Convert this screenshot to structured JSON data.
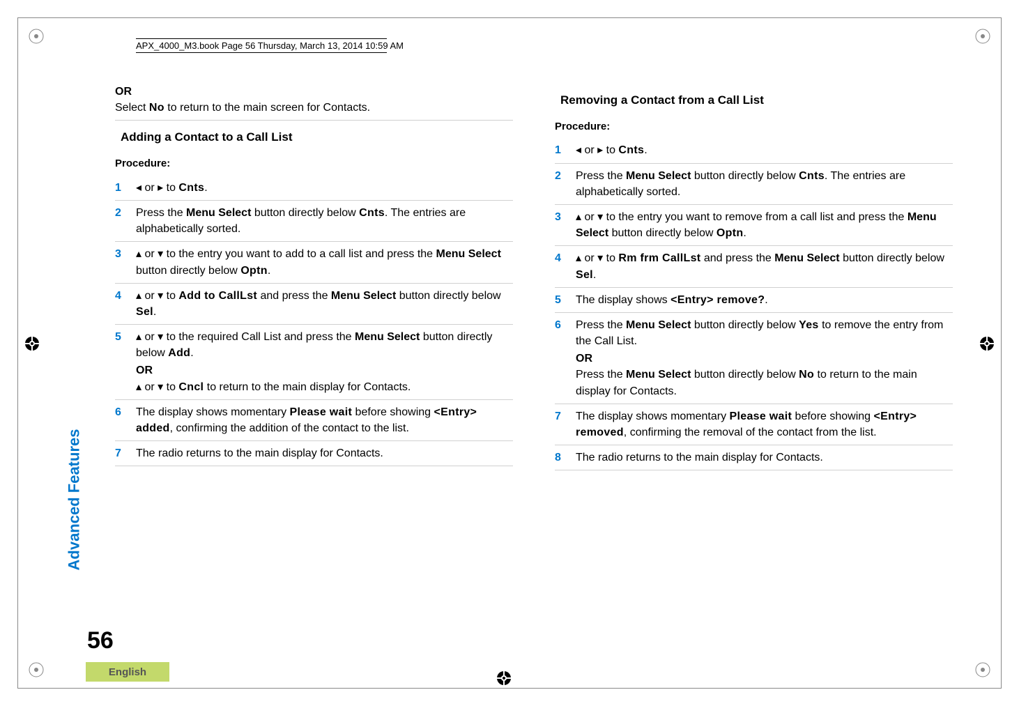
{
  "book_header": "APX_4000_M3.book  Page 56  Thursday, March 13, 2014  10:59 AM",
  "side_tab": "Advanced Features",
  "page_number": "56",
  "english_label": "English",
  "glyphs": {
    "left_tri": "◂",
    "right_tri": "▸",
    "up_tri": "▴",
    "down_tri": "▾"
  },
  "left_col": {
    "top_or": "OR",
    "top_select_no": "Select ",
    "top_no": "No",
    "top_tail": " to return to the main screen for Contacts.",
    "section_title": "Adding a Contact to a Call List",
    "procedure_label": "Procedure:",
    "step1_lead": "",
    "step1_or": " or ",
    "step1_to": " to ",
    "step1_cnts": "Cnts",
    "step1_end": ".",
    "step2_p1": "Press the ",
    "step2_ms": "Menu Select",
    "step2_p2": " button directly below ",
    "step2_cnts": "Cnts",
    "step2_p3": ". The entries are alphabetically sorted.",
    "step3_or": " or ",
    "step3_txt": " to the entry you want to add to a call list and press the ",
    "step3_ms": "Menu Select",
    "step3_p2": " button directly below ",
    "step3_optn": "Optn",
    "step3_end": ".",
    "step4_or": " or ",
    "step4_to": " to ",
    "step4_add": "Add to CallLst",
    "step4_p2": " and press the ",
    "step4_ms": "Menu Select",
    "step4_p3": " button directly below ",
    "step4_sel": "Sel",
    "step4_end": ".",
    "step5_or": " or ",
    "step5_txt": " to the required Call List and press the ",
    "step5_ms": "Menu Select",
    "step5_p2": " button directly below ",
    "step5_add": "Add",
    "step5_end": ".",
    "step5_orlabel": "OR",
    "step5b_or": " or ",
    "step5b_to": " to ",
    "step5b_cncl": "Cncl",
    "step5b_txt": " to return to the main display for Contacts.",
    "step6_p1": "The display shows momentary ",
    "step6_pw": "Please wait",
    "step6_p2": " before showing ",
    "step6_entry": "<Entry> added",
    "step6_p3": ", confirming the addition of the contact to the list.",
    "step7": "The radio returns to the main display for Contacts."
  },
  "right_col": {
    "section_title": "Removing a Contact from a Call List",
    "procedure_label": "Procedure:",
    "step1_or": " or ",
    "step1_to": " to ",
    "step1_cnts": "Cnts",
    "step1_end": ".",
    "step2_p1": "Press the ",
    "step2_ms": "Menu Select",
    "step2_p2": " button directly below ",
    "step2_cnts": "Cnts",
    "step2_p3": ". The entries are alphabetically sorted.",
    "step3_or": " or ",
    "step3_txt": " to the entry you want to remove from a call list and press the ",
    "step3_ms": "Menu Select",
    "step3_p2": " button directly below ",
    "step3_optn": "Optn",
    "step3_end": ".",
    "step4_or": " or ",
    "step4_to": " to ",
    "step4_rm": "Rm frm CallLst",
    "step4_p2": " and press the ",
    "step4_ms": "Menu Select",
    "step4_p3": " button directly below ",
    "step4_sel": "Sel",
    "step4_end": ".",
    "step5_p1": "The display shows ",
    "step5_entry": "<Entry> remove?",
    "step5_end": ".",
    "step6_p1": "Press the ",
    "step6_ms": "Menu Select",
    "step6_p2": " button directly below ",
    "step6_yes": "Yes",
    "step6_p3": " to remove the entry from the Call List.",
    "step6_orlabel": "OR",
    "step6b_p1": "Press the ",
    "step6b_ms": "Menu Select",
    "step6b_p2": " button directly below ",
    "step6b_no": "No",
    "step6b_p3": " to return to the main display for Contacts.",
    "step7_p1": "The display shows momentary ",
    "step7_pw": "Please wait",
    "step7_p2": " before showing ",
    "step7_entry": "<Entry> removed",
    "step7_p3": ", confirming the removal of the contact from the list.",
    "step8": "The radio returns to the main display for Contacts."
  }
}
